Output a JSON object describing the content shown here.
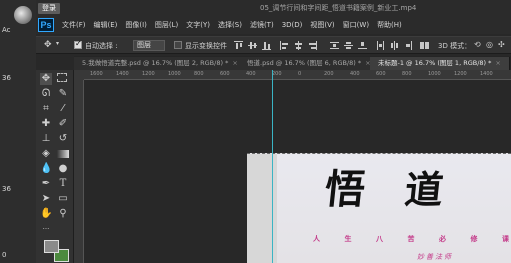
{
  "desktop": {
    "label_top": "Ac",
    "label_mid": "36",
    "label_low": "36",
    "label_bottom": "0"
  },
  "titlebar": {
    "login": "登录",
    "file_title": "05_调节行间和字间距_悟道书籍案例_新业工.mp4"
  },
  "app": {
    "logo": "Ps",
    "menu": [
      "文件(F)",
      "编辑(E)",
      "图像(I)",
      "图层(L)",
      "文字(Y)",
      "选择(S)",
      "滤镜(T)",
      "3D(D)",
      "视图(V)",
      "窗口(W)",
      "帮助(H)"
    ]
  },
  "options": {
    "auto_select_label": "自动选择 :",
    "auto_select_value": "图层",
    "show_transform_label": "显示变换控件",
    "mode_3d_label": "3D 模式："
  },
  "tabs": [
    {
      "label": "5.我做悟道完整.psd @ 16.7% (图层 2, RGB/8) *",
      "active": false
    },
    {
      "label": "悟道.psd @ 16.7% (图层 6, RGB/8) *",
      "active": false
    },
    {
      "label": "未标题-1 @ 16.7% (图层 1, RGB/8) *",
      "active": true
    }
  ],
  "ruler": {
    "h_ticks": [
      "1600",
      "1400",
      "1200",
      "1000",
      "800",
      "600",
      "400",
      "200",
      "0",
      "200",
      "400",
      "600",
      "800",
      "1000",
      "1200",
      "1400"
    ]
  },
  "artwork": {
    "char1": "悟",
    "char2": "道",
    "subtitle": [
      "人",
      "生",
      "八",
      "苦",
      "必",
      "修",
      "课"
    ],
    "author": "妙善法师"
  },
  "colors": {
    "foreground": "#8a8a8a",
    "background": "#4c8a3e",
    "guide": "#3ab4c4",
    "accent_text": "#c43c8a"
  }
}
